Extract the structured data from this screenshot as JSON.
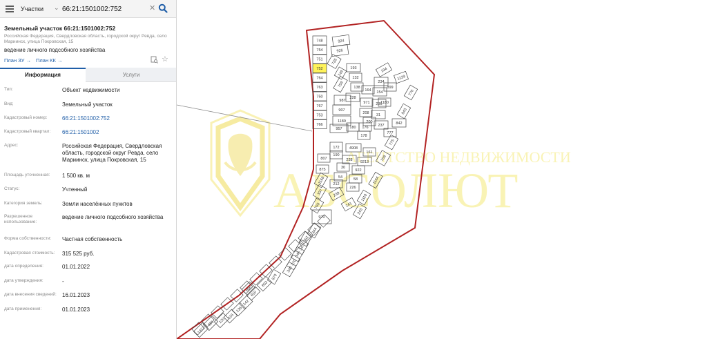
{
  "search": {
    "layer": "Участки",
    "query": "66:21:1501002:752"
  },
  "object": {
    "title": "Земельный участок 66:21:1501002:752",
    "address": "Российская Федерация, Свердловская область, городской округ Ревда, село Мариинск, улица Покровская, 15",
    "usage": "ведение личного подсобного хозяйства",
    "plan_zu": "План ЗУ →",
    "plan_kk": "План КК →"
  },
  "tabs": {
    "info": "Информация",
    "services": "Услуги"
  },
  "properties": [
    {
      "label": "Тип:",
      "value": "Объект недвижимости",
      "link": false
    },
    {
      "label": "Вид:",
      "value": "Земельный участок",
      "link": false
    },
    {
      "label": "Кадастровый номер:",
      "value": "66:21:1501002:752",
      "link": true
    },
    {
      "label": "Кадастровый квартал:",
      "value": "66:21:1501002",
      "link": true
    },
    {
      "label": "Адрес:",
      "value": "Российская Федерация, Свердловская область, городской округ Ревда, село Мариинск, улица Покровская, 15",
      "link": false
    },
    {
      "label": "Площадь уточненная:",
      "value": "1 500 кв. м",
      "link": false
    },
    {
      "label": "Статус:",
      "value": "Учтенный",
      "link": false
    },
    {
      "label": "Категория земель:",
      "value": "Земли населённых пунктов",
      "link": false
    },
    {
      "label": "Разрешенное использование:",
      "value": "ведение личного подсобного хозяйства",
      "link": false
    },
    {
      "label": "Форма собственности:",
      "value": "Частная собственность",
      "link": false
    },
    {
      "label": "Кадастровая стоимость:",
      "value": "315 525 руб.",
      "link": false
    },
    {
      "label": "дата определения:",
      "value": "01.01.2022",
      "link": false
    },
    {
      "label": "дата утверждения:",
      "value": "-",
      "link": false
    },
    {
      "label": "дата внесения сведений:",
      "value": "16.01.2023",
      "link": false
    },
    {
      "label": "дата применения:",
      "value": "01.01.2023",
      "link": false
    }
  ],
  "watermark": {
    "line1": "АГЕНТСТВО НЕДВИЖИМОСТИ",
    "line2": "АБСОЛЮТ"
  },
  "map": {
    "highlighted_parcel": "752",
    "parcel_labels_left": [
      "748",
      "754",
      "751",
      "752",
      "764",
      "763",
      "750",
      "767",
      "753",
      "766"
    ],
    "parcel_labels_mid": [
      "924",
      "926",
      "735",
      "749",
      "759",
      "987",
      "907",
      "1189",
      "957",
      "193",
      "132",
      "138",
      "228",
      "194",
      "234",
      "164",
      "154",
      "971",
      "236",
      "208",
      "31",
      "200",
      "237",
      "178",
      "180",
      "176",
      "1180",
      "1129",
      "899",
      "776",
      "843",
      "842",
      "777",
      "775",
      "172",
      "190",
      "4908",
      "161",
      "238",
      "9213",
      "768",
      "807",
      "875",
      "30",
      "922",
      "54",
      "58",
      "212",
      "1164",
      "1110",
      "226",
      "239",
      "241",
      "243",
      "1168",
      "337",
      "765",
      "970",
      "344",
      "352",
      "347",
      "346",
      "370",
      "340",
      "870",
      "803",
      "866",
      "810",
      "142",
      "136",
      "116",
      "981",
      "1312",
      "120"
    ],
    "colors": {
      "boundary": "#b22222",
      "parcel_stroke": "#444444",
      "highlight_fill": "#fff35a",
      "watermark": "#f5ea7a"
    }
  }
}
